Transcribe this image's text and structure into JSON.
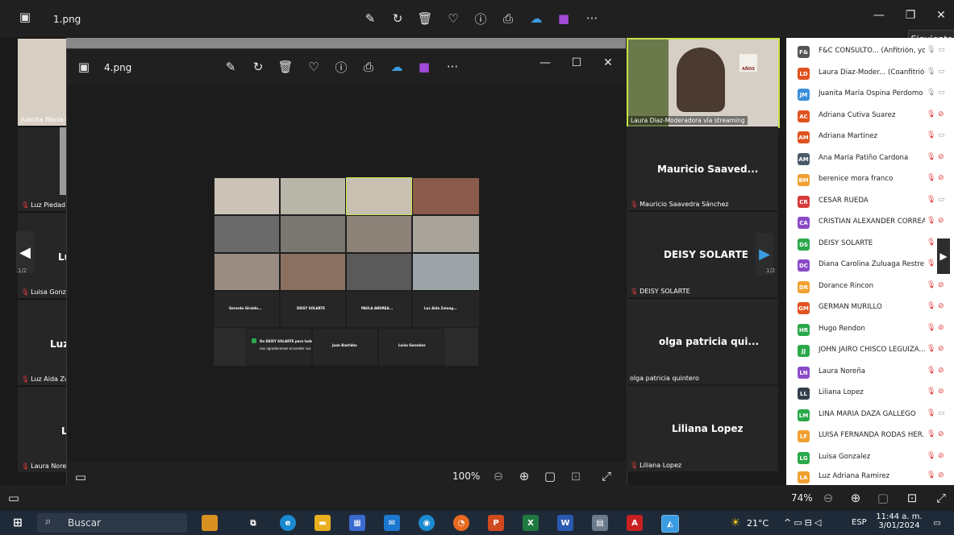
{
  "outer_window": {
    "filename": "1.png",
    "tooltip": "Siguiente",
    "zoom": "74%"
  },
  "inner_window": {
    "filename": "4.png",
    "zoom": "100%"
  },
  "left_tiles": [
    {
      "name": "Juanita Maria C",
      "big": ""
    },
    {
      "name": "Luz Piedad",
      "big": ""
    },
    {
      "name": "Luisa Gonza",
      "big": "Lu"
    },
    {
      "name": "Luz Aida Zul",
      "big": "Luz"
    },
    {
      "name": "Laura Noreñ",
      "big": "L"
    }
  ],
  "left_page": "1/2",
  "right_page": "1/2",
  "main_video": {
    "label": "Laura Diaz-Moderadora vía streaming",
    "logo": "AÑOS"
  },
  "right_tiles": [
    {
      "big": "Mauricio Saaved...",
      "name": "Mauricio Saavedra Sánchez",
      "muted": true
    },
    {
      "big": "DEISY SOLARTE",
      "name": "DEISY SOLARTE",
      "muted": true
    },
    {
      "big": "olga patricia qui...",
      "name": "olga patricia quintero",
      "muted": false
    },
    {
      "big": "Liliana Lopez",
      "name": "Liliana Lopez",
      "muted": true
    }
  ],
  "participants": [
    {
      "initials": "F&",
      "name": "F&C CONSULTO... (Anfitrión, yo)",
      "color": "#555555",
      "mic": "on",
      "cam": "off"
    },
    {
      "initials": "LD",
      "name": "Laura Diaz-Moder... (Coanfitrión)",
      "color": "#e0531f",
      "mic": "on",
      "cam": "off"
    },
    {
      "initials": "JM",
      "name": "Juanita María Ospina Perdomo",
      "color": "#3a8fd8",
      "mic": "on",
      "cam": "off"
    },
    {
      "initials": "AC",
      "name": "Adriana Cutiva Suarez",
      "color": "#e0531f",
      "mic": "muted",
      "cam": "muted"
    },
    {
      "initials": "AM",
      "name": "Adriana Martinez",
      "color": "#e0531f",
      "mic": "muted",
      "cam": "off"
    },
    {
      "initials": "AM",
      "name": "Ana María Patiño Cardona",
      "color": "#4a5a6a",
      "mic": "muted",
      "cam": "muted"
    },
    {
      "initials": "BM",
      "name": "berenice mora franco",
      "color": "#f0a030",
      "mic": "muted",
      "cam": "muted"
    },
    {
      "initials": "CR",
      "name": "CESAR RUEDA",
      "color": "#d83a3a",
      "mic": "muted",
      "cam": "off"
    },
    {
      "initials": "CA",
      "name": "CRISTIAN ALEXANDER CORREA...",
      "color": "#8a4ac8",
      "mic": "muted",
      "cam": "muted"
    },
    {
      "initials": "DS",
      "name": "DEISY SOLARTE",
      "color": "#2aa84a",
      "mic": "muted",
      "cam": "muted"
    },
    {
      "initials": "DC",
      "name": "Diana Carolina Zuluaga Restre...",
      "color": "#8a4ac8",
      "mic": "muted",
      "cam": "muted"
    },
    {
      "initials": "DR",
      "name": "Dorance Rincon",
      "color": "#f0a030",
      "mic": "muted",
      "cam": "muted"
    },
    {
      "initials": "GM",
      "name": "GERMAN MURILLO",
      "color": "#e0531f",
      "mic": "muted",
      "cam": "muted"
    },
    {
      "initials": "HR",
      "name": "Hugo Rendon",
      "color": "#2aa84a",
      "mic": "muted",
      "cam": "muted"
    },
    {
      "initials": "JJ",
      "name": "JOHN JAIRO CHISCO LEGUIZA...",
      "color": "#2aa84a",
      "mic": "muted",
      "cam": "muted"
    },
    {
      "initials": "LN",
      "name": "Laura Noreña",
      "color": "#8a4ac8",
      "mic": "muted",
      "cam": "muted"
    },
    {
      "initials": "LL",
      "name": "Liliana Lopez",
      "color": "#333f4a",
      "mic": "muted",
      "cam": "muted"
    },
    {
      "initials": "LM",
      "name": "LINA MARIA DAZA GALLEGO",
      "color": "#2aa84a",
      "mic": "muted",
      "cam": "off"
    },
    {
      "initials": "LF",
      "name": "LUISA FERNANDA RODAS HER...",
      "color": "#f0a030",
      "mic": "muted",
      "cam": "muted"
    },
    {
      "initials": "LG",
      "name": "Luisa Gonzalez",
      "color": "#2aa84a",
      "mic": "muted",
      "cam": "muted"
    },
    {
      "initials": "LA",
      "name": "Luz Adriana Ramirez",
      "color": "#f0a030",
      "mic": "muted",
      "cam": "muted"
    }
  ],
  "mini": {
    "names_row": [
      "Gerardo Giraldo...",
      "DEISY SOLARTE",
      "PAULA ANDREA...",
      "Luz Aida Zuluag..."
    ],
    "names_row2": [
      "Juan Bastidas",
      "Luisa Gonzalez"
    ],
    "chat_title": "De DEISY SOLARTE para todos",
    "chat_text": "nos agradecemos encender sus cámaras**"
  },
  "taskbar": {
    "search_label": "Buscar",
    "temperature": "21°C",
    "language": "ESP",
    "time": "11:44 a. m.",
    "date": "3/01/2024"
  },
  "colors": {
    "accent": "#c9e34a",
    "muted": "#e23b3b"
  }
}
